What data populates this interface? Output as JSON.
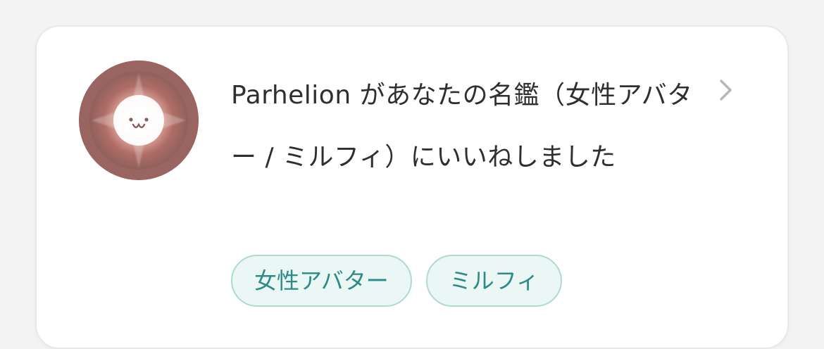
{
  "notification": {
    "message": "Parhelion があなたの名鑑（女性アバター / ミルフィ）にいいねしました",
    "tags": [
      {
        "label": "女性アバター"
      },
      {
        "label": "ミルフィ"
      }
    ]
  },
  "icons": {
    "avatar": "user-avatar",
    "chevron": "chevron-right-icon"
  },
  "colors": {
    "page_background": "#f3f3f3",
    "card_background": "#ffffff",
    "text": "#2f2f2f",
    "tag_background": "#eaf7f5",
    "tag_border": "#afd9d3",
    "tag_text": "#2e8a86",
    "chevron": "#b8b8b8"
  }
}
